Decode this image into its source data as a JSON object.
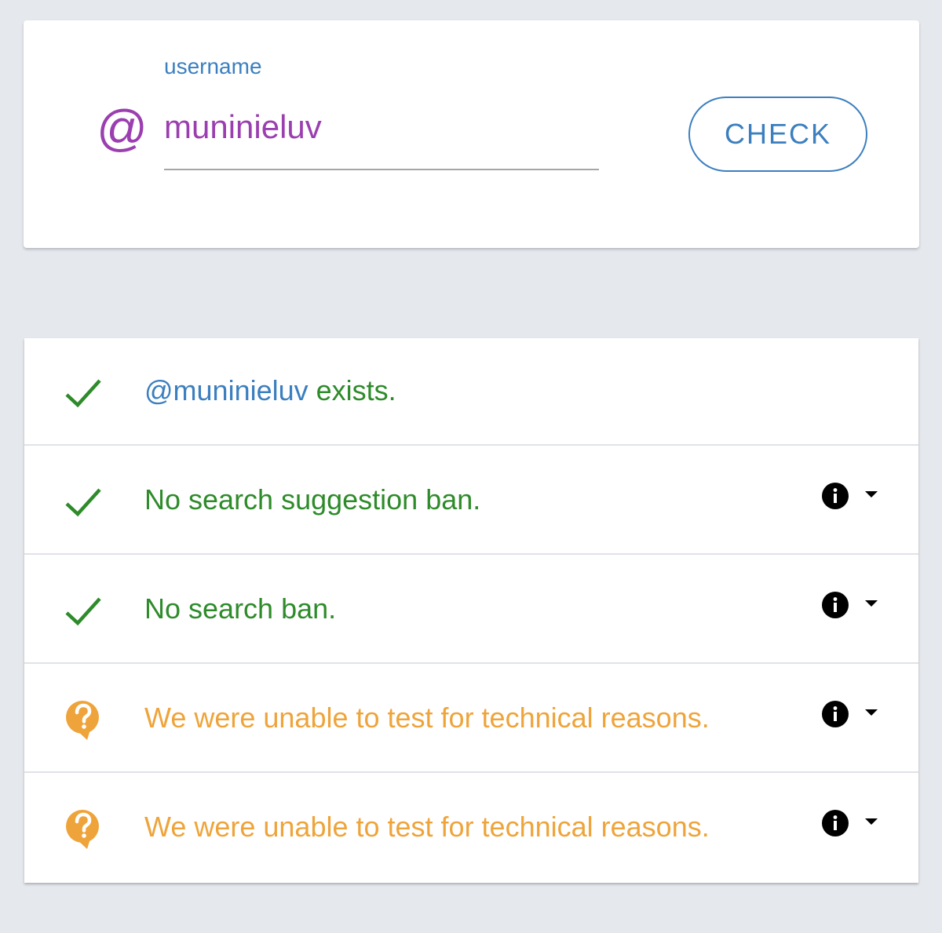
{
  "search": {
    "label": "username",
    "prefix_icon": "at-sign-icon",
    "value": "muninieluv",
    "placeholder": "",
    "button_label": "CHECK"
  },
  "results": [
    {
      "status": "pass",
      "icon": "checkmark-icon",
      "handle": "@muninieluv",
      "message": " exists.",
      "has_details": false
    },
    {
      "status": "pass",
      "icon": "checkmark-icon",
      "message": "No search suggestion ban.",
      "has_details": true
    },
    {
      "status": "pass",
      "icon": "checkmark-icon",
      "message": "No search ban.",
      "has_details": true
    },
    {
      "status": "unknown",
      "icon": "question-bubble-icon",
      "message": "We were unable to test for technical reasons.",
      "has_details": true
    },
    {
      "status": "unknown",
      "icon": "question-bubble-icon",
      "message": "We were unable to test for technical reasons.",
      "has_details": true
    }
  ],
  "colors": {
    "page_background": "#e5e9ee",
    "accent_blue": "#3b7fbf",
    "accent_purple": "#9b3fb0",
    "success_green": "#2e8b2a",
    "warning_orange": "#eea43a"
  }
}
